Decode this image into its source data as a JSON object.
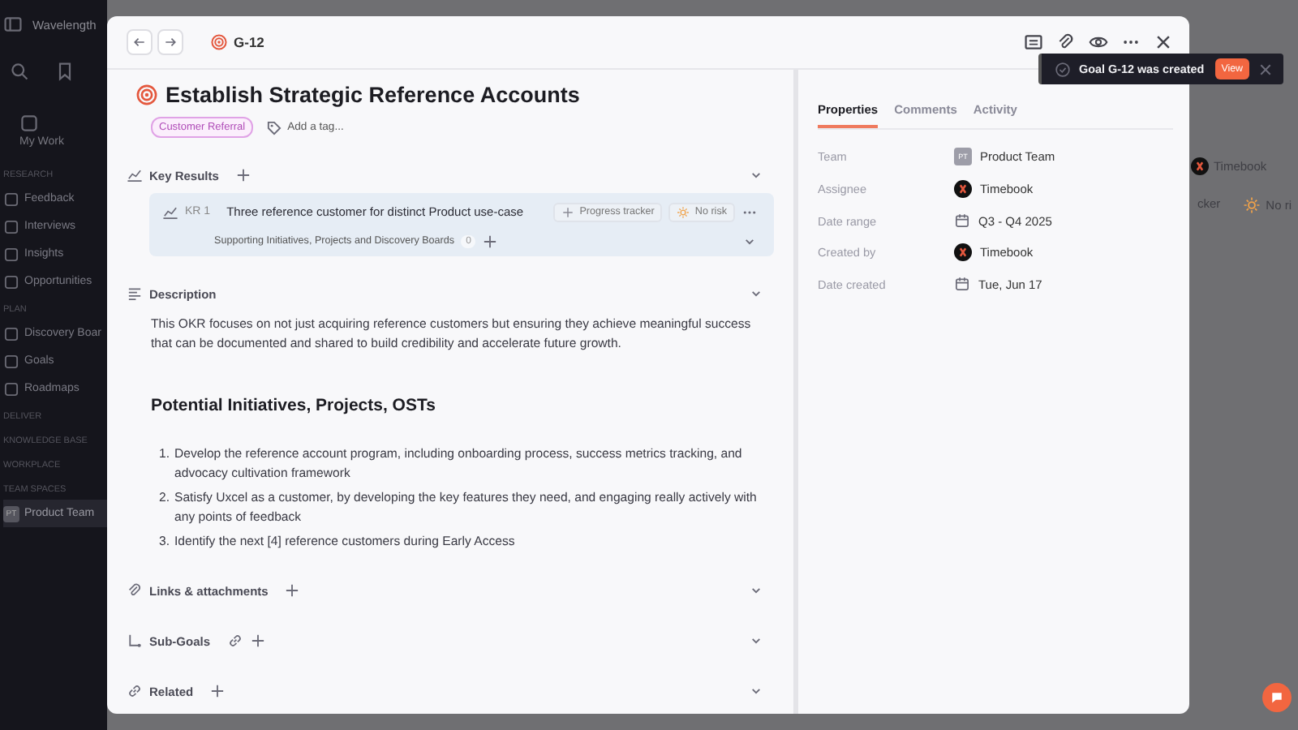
{
  "sidebar": {
    "workspace": "Wavelength",
    "top_item": {
      "label": "My Work"
    },
    "sections": [
      {
        "title": "RESEARCH",
        "items": [
          {
            "label": "Feedback",
            "selected": false
          },
          {
            "label": "Interviews",
            "selected": false
          },
          {
            "label": "Insights",
            "selected": false
          },
          {
            "label": "Opportunities",
            "selected": false
          }
        ]
      },
      {
        "title": "PLAN",
        "items": [
          {
            "label": "Discovery Boar",
            "selected": false
          },
          {
            "label": "Goals",
            "selected": false
          },
          {
            "label": "Roadmaps",
            "selected": false
          }
        ]
      },
      {
        "title": "DELIVER"
      },
      {
        "title": "KNOWLEDGE BASE"
      },
      {
        "title": "WORKPLACE"
      },
      {
        "title": "TEAM SPACES",
        "items": [
          {
            "label": "Product Team",
            "selected": true,
            "avatar": "PT"
          }
        ]
      }
    ]
  },
  "background_rows": [
    {
      "assignee": "Timebook"
    },
    {
      "progress": "cker",
      "risk": "No ri"
    }
  ],
  "modal": {
    "breadcrumb": "G-12",
    "title": "Establish Strategic Reference Accounts",
    "tags": [
      "Customer Referral"
    ],
    "add_tag": "Add a tag...",
    "key_results": {
      "label": "Key Results",
      "items": [
        {
          "code": "KR 1",
          "title": "Three reference customer for distinct Product use-case",
          "progress_action": "Progress tracker",
          "risk": "No risk",
          "supporting_label": "Supporting Initiatives, Projects and Discovery Boards",
          "supporting_count": "0"
        }
      ]
    },
    "description": {
      "label": "Description",
      "paragraph": "This OKR focuses on not just acquiring reference customers but ensuring they achieve meaningful success that can be documented and shared to build credibility and accelerate future growth.",
      "heading": "Potential Initiatives, Projects, OSTs",
      "list": [
        {
          "number": "1.",
          "text": "Develop the reference account program, including onboarding process, success metrics tracking, and advocacy cultivation framework"
        },
        {
          "number": "2.",
          "text": "Satisfy Uxcel as a customer, by developing the key features they need, and engaging really actively with any points of feedback"
        },
        {
          "number": "3.",
          "text": "Identify the next [4] reference customers during Early Access"
        }
      ]
    },
    "sections": [
      {
        "kind": "links",
        "label": "Links & attachments"
      },
      {
        "kind": "subgoals",
        "label": "Sub-Goals"
      },
      {
        "kind": "related",
        "label": "Related"
      }
    ],
    "tabs": [
      {
        "label": "Properties",
        "selected": true
      },
      {
        "label": "Comments",
        "selected": false
      },
      {
        "label": "Activity",
        "selected": false
      }
    ],
    "properties": [
      {
        "label": "Team",
        "kind": "team",
        "avatar": "PT",
        "value": "Product Team"
      },
      {
        "label": "Assignee",
        "kind": "user",
        "value": "Timebook"
      },
      {
        "label": "Date range",
        "kind": "date",
        "value": "Q3 - Q4 2025"
      },
      {
        "label": "Created by",
        "kind": "user",
        "value": "Timebook"
      },
      {
        "label": "Date created",
        "kind": "date",
        "value": "Tue, Jun 17"
      }
    ]
  },
  "toast": {
    "message": "Goal G-12 was created",
    "action": "View"
  }
}
